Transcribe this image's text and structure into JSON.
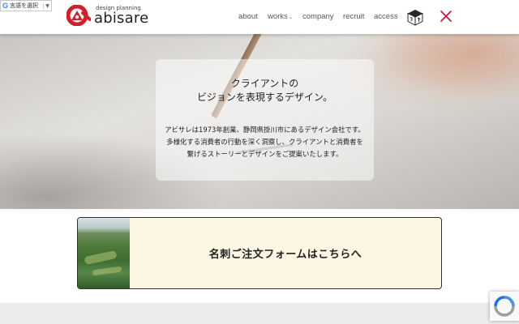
{
  "translate_widget": {
    "g_mark": "G",
    "label": "言語を選択",
    "arrow": "▼"
  },
  "logo": {
    "tagline": "design planning",
    "name": "abisare",
    "brand_color": "#d4202a"
  },
  "nav": {
    "items": [
      {
        "label": "about"
      },
      {
        "label": "works"
      },
      {
        "label": "company"
      },
      {
        "label": "recruit"
      },
      {
        "label": "access"
      }
    ],
    "works_chevron": "⌄",
    "cube_icon": "cube-icon",
    "close_icon": "close-icon",
    "close_color": "#c8102e"
  },
  "hero": {
    "title_line1": "クライアントの",
    "title_line2": "ビジョンを表現するデザイン。",
    "body_line1": "アビサレは1973年創業、静岡県掛川市にあるデザイン会社です。",
    "body_line2": "多様化する消費者の行動を深く洞察し、クライアントと消費者を",
    "body_line3": "繋げるストーリーとデザインをご提案いたします。"
  },
  "banner": {
    "label": "名刺ご注文フォームはこちらへ",
    "background": "#fcf6e2"
  },
  "recaptcha": {
    "icon": "recaptcha-icon"
  }
}
